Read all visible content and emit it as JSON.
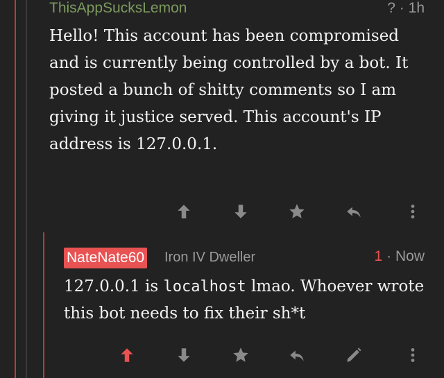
{
  "comment": {
    "username": "ThisAppSucksLemon",
    "meta": "? · 1h",
    "body": "Hello! This account has been compromised and is currently being controlled by a bot. It posted a bunch of shitty comments so I am giving it justice served. This account's IP address is 127.0.0.1.",
    "actions": [
      "upvote-icon",
      "downvote-icon",
      "save-star-icon",
      "reply-icon",
      "more-vertical-icon"
    ]
  },
  "reply": {
    "username": "NateNate60",
    "flair": "Iron IV Dweller",
    "score": "1",
    "time": "· Now",
    "text_before": "127.0.0.1 is ",
    "text_code": "localhost",
    "text_after": " lmao. Whoever wrote this bot needs to fix their sh*t",
    "actions": [
      "upvote-icon-active",
      "downvote-icon",
      "save-star-icon",
      "reply-icon",
      "edit-pencil-icon",
      "more-vertical-icon"
    ]
  },
  "colors": {
    "background": "#222222",
    "thread_line": "#b93b3b",
    "username_green": "#7d9a5f",
    "badge_red": "#e85252",
    "icon_grey": "#8a8a8a",
    "upvote_active": "#e85252"
  }
}
